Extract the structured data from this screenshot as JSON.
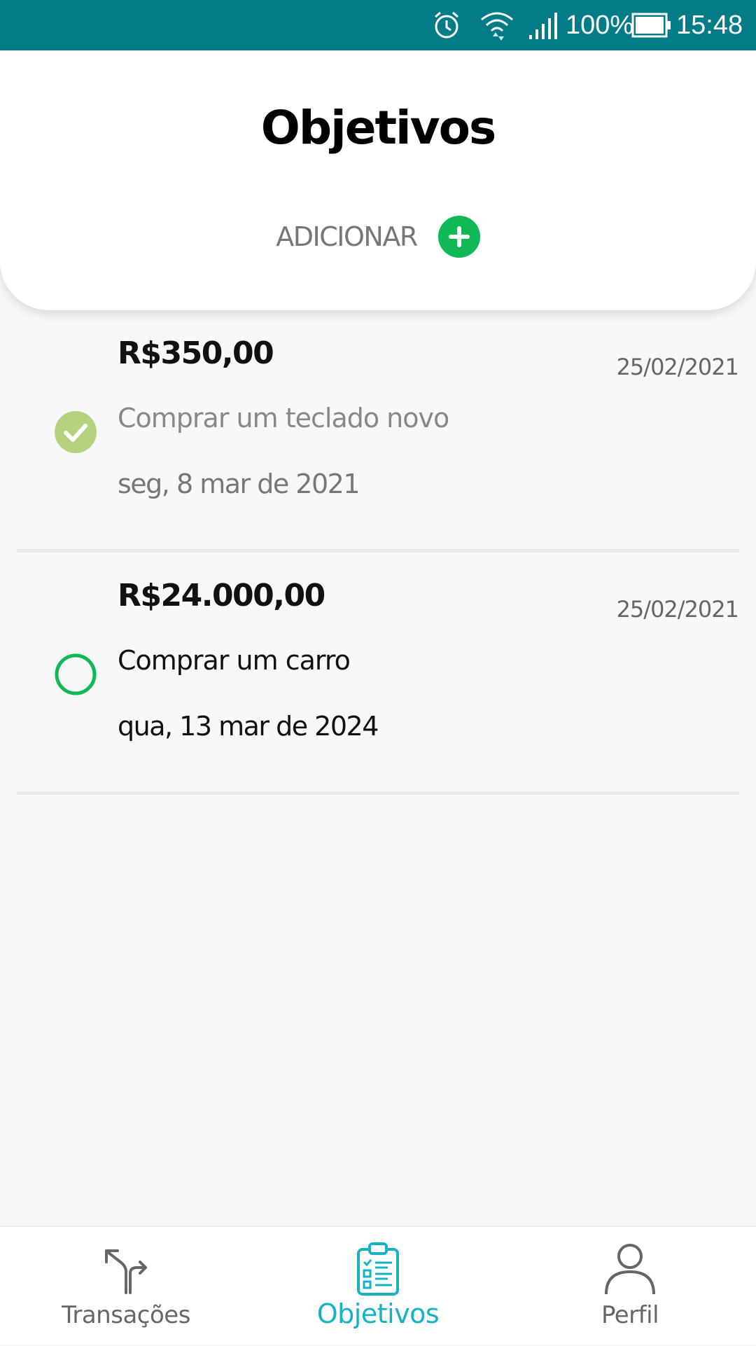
{
  "status_bar": {
    "battery_percent": "100%",
    "time": "15:48",
    "icons": [
      "alarm-icon",
      "wifi-icon",
      "signal-icon",
      "battery-icon"
    ]
  },
  "header": {
    "title": "Objetivos",
    "add_label": "ADICIONAR",
    "add_icon": "plus-circle-icon"
  },
  "goals": [
    {
      "amount": "R$350,00",
      "created_date": "25/02/2021",
      "description": "Comprar um teclado novo",
      "deadline": "seg, 8 mar de 2021",
      "completed": true,
      "status_icon": "check-circle-icon"
    },
    {
      "amount": "R$24.000,00",
      "created_date": "25/02/2021",
      "description": "Comprar um carro",
      "deadline": "qua, 13 mar de 2024",
      "completed": false,
      "status_icon": "empty-circle-icon"
    }
  ],
  "bottom_nav": {
    "items": [
      {
        "label": "Transações",
        "icon": "fork-arrows-icon",
        "active": false
      },
      {
        "label": "Objetivos",
        "icon": "clipboard-checklist-icon",
        "active": true
      },
      {
        "label": "Perfil",
        "icon": "person-icon",
        "active": false
      }
    ]
  },
  "colors": {
    "status_bar": "#047c88",
    "accent_green": "#10b955",
    "done_check": "#b5d27e",
    "active_nav": "#16b3c4"
  }
}
